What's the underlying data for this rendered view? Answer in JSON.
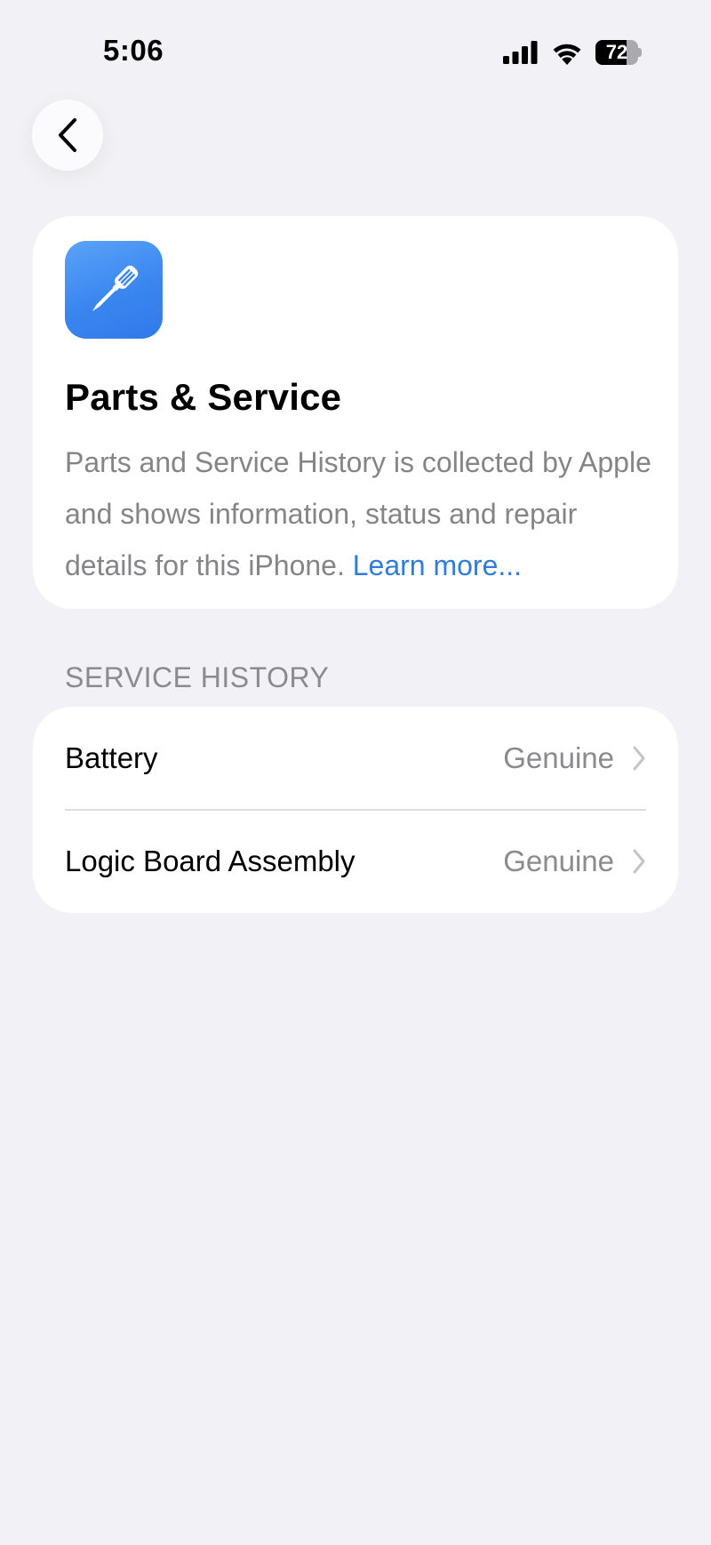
{
  "status_bar": {
    "time": "5:06",
    "battery_level": "72",
    "battery_fraction": 0.72
  },
  "navigation": {
    "back_icon": "chevron-left-icon"
  },
  "header_card": {
    "icon": "screwdriver-icon",
    "icon_color": "#3a86f0",
    "title": "Parts & Service",
    "description": "Parts and Service History is collected by Apple and shows information, status and repair details for this iPhone.",
    "learn_more": "Learn more..."
  },
  "service_history": {
    "section_title": "SERVICE HISTORY",
    "items": [
      {
        "label": "Battery",
        "status": "Genuine"
      },
      {
        "label": "Logic Board Assembly",
        "status": "Genuine"
      }
    ]
  },
  "colors": {
    "background": "#f1f1f6",
    "link": "#2f7cdd",
    "secondary_text": "#8a8a8f"
  }
}
